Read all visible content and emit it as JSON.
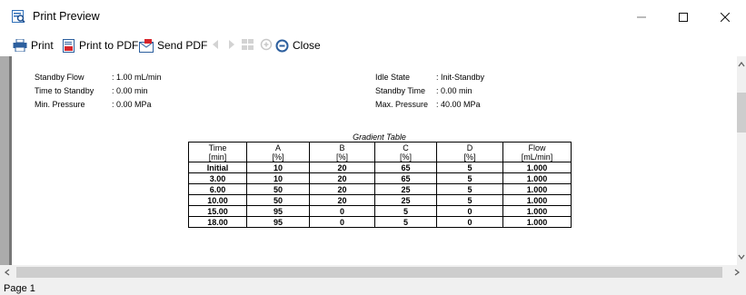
{
  "window": {
    "title": "Print Preview",
    "app_icon": "print-preview-icon",
    "controls": [
      "minimize-icon",
      "maximize-icon",
      "close-icon"
    ]
  },
  "toolbar": {
    "print_label": "Print",
    "print_to_pdf_label": "Print to PDF",
    "send_pdf_label": "Send PDF",
    "close_label": "Close",
    "icons": [
      "printer-icon",
      "pdf-icon",
      "send-pdf-icon",
      "first-page-icon",
      "next-page-icon",
      "multi-page-icon",
      "zoom-in-icon",
      "zoom-out-icon"
    ]
  },
  "report": {
    "left_info": [
      {
        "label": "Standby Flow",
        "value": ": 1.00 mL/min"
      },
      {
        "label": "Time to Standby",
        "value": ": 0.00 min"
      },
      {
        "label": "Min. Pressure",
        "value": ": 0.00 MPa"
      }
    ],
    "right_info": [
      {
        "label": "Idle State",
        "value": ": Init-Standby"
      },
      {
        "label": "Standby Time",
        "value": ": 0.00 min"
      },
      {
        "label": "Max. Pressure",
        "value": ": 40.00 MPa"
      }
    ],
    "gradient_table": {
      "caption": "Gradient Table",
      "headers": [
        {
          "name": "Time",
          "unit": "[min]"
        },
        {
          "name": "A",
          "unit": "[%]"
        },
        {
          "name": "B",
          "unit": "[%]"
        },
        {
          "name": "C",
          "unit": "[%]"
        },
        {
          "name": "D",
          "unit": "[%]"
        },
        {
          "name": "Flow",
          "unit": "[mL/min]"
        }
      ],
      "rows": [
        [
          "Initial",
          "10",
          "20",
          "65",
          "5",
          "1.000"
        ],
        [
          "3.00",
          "10",
          "20",
          "65",
          "5",
          "1.000"
        ],
        [
          "6.00",
          "50",
          "20",
          "25",
          "5",
          "1.000"
        ],
        [
          "10.00",
          "50",
          "20",
          "25",
          "5",
          "1.000"
        ],
        [
          "15.00",
          "95",
          "0",
          "5",
          "0",
          "1.000"
        ],
        [
          "18.00",
          "95",
          "0",
          "5",
          "0",
          "1.000"
        ]
      ]
    }
  },
  "status": {
    "page_label": "Page 1"
  }
}
